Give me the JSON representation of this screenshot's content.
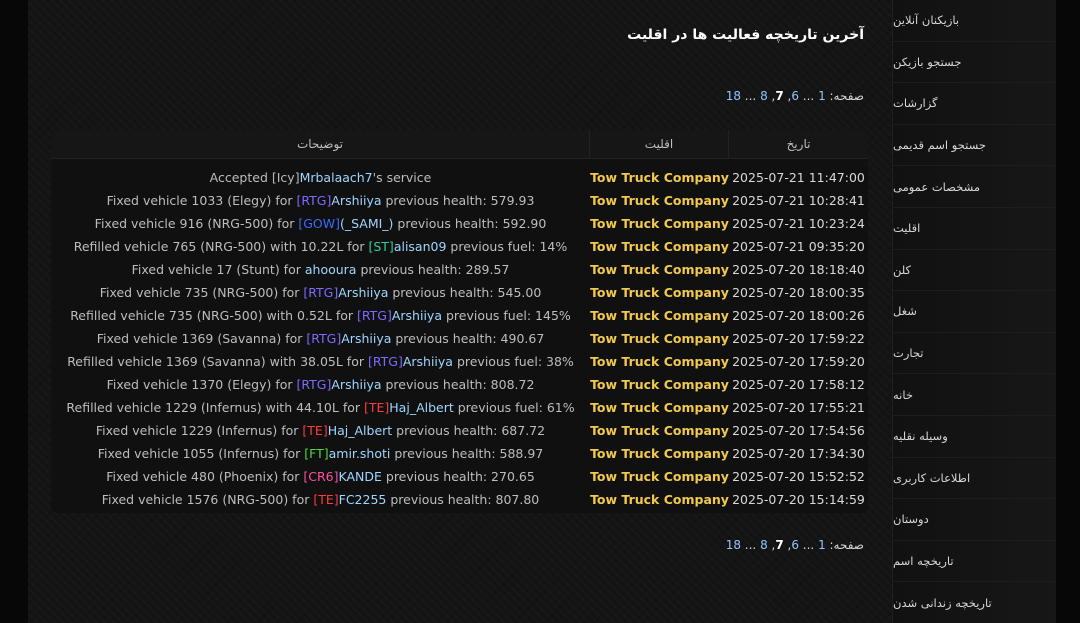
{
  "page": {
    "title": "آخرین تاریخچه فعالیت ها در اقلیت"
  },
  "pagination": {
    "label": "صفحه:",
    "pages": [
      "1",
      "...",
      "6",
      "7",
      "8",
      "...",
      "18"
    ],
    "current": "7"
  },
  "table": {
    "headers": {
      "date": "تاریخ",
      "faction": "اقلیت",
      "description": "توضیحات"
    },
    "rows": [
      {
        "date": "2025-07-21 11:47:00",
        "faction": "Tow Truck Company",
        "desc": [
          {
            "t": "Accepted "
          },
          {
            "t": "[Icy]",
            "c": "#b8b8b8"
          },
          {
            "t": "Mrbalaach7",
            "c": "#9fd6ff"
          },
          {
            "t": "'s service"
          }
        ]
      },
      {
        "date": "2025-07-21 10:28:41",
        "faction": "Tow Truck Company",
        "desc": [
          {
            "t": "Fixed vehicle 1033 (Elegy) for "
          },
          {
            "t": "[RTG]",
            "c": "#7b6cff"
          },
          {
            "t": "Arshiiya",
            "c": "#9fd6ff"
          },
          {
            "t": " previous health: 579.93"
          }
        ]
      },
      {
        "date": "2025-07-21 10:23:24",
        "faction": "Tow Truck Company",
        "desc": [
          {
            "t": "Fixed vehicle 916 (NRG-500) for "
          },
          {
            "t": "[GOW]",
            "c": "#3b6bff"
          },
          {
            "t": "(_SAMI_)",
            "c": "#9fd6ff"
          },
          {
            "t": " previous health: 592.90"
          }
        ]
      },
      {
        "date": "2025-07-21 09:35:20",
        "faction": "Tow Truck Company",
        "desc": [
          {
            "t": "Refilled vehicle 765 (NRG-500) with 10.22L for "
          },
          {
            "t": "[ST]",
            "c": "#2fcf9a"
          },
          {
            "t": "alisan09",
            "c": "#9fd6ff"
          },
          {
            "t": " previous fuel: 14%"
          }
        ]
      },
      {
        "date": "2025-07-20 18:18:40",
        "faction": "Tow Truck Company",
        "desc": [
          {
            "t": "Fixed vehicle 17 (Stunt) for "
          },
          {
            "t": "ahooura",
            "c": "#9fd6ff"
          },
          {
            "t": " previous health: 289.57"
          }
        ]
      },
      {
        "date": "2025-07-20 18:00:35",
        "faction": "Tow Truck Company",
        "desc": [
          {
            "t": "Fixed vehicle 735 (NRG-500) for "
          },
          {
            "t": "[RTG]",
            "c": "#7b6cff"
          },
          {
            "t": "Arshiiya",
            "c": "#9fd6ff"
          },
          {
            "t": " previous health: 545.00"
          }
        ]
      },
      {
        "date": "2025-07-20 18:00:26",
        "faction": "Tow Truck Company",
        "desc": [
          {
            "t": "Refilled vehicle 735 (NRG-500) with 0.52L for "
          },
          {
            "t": "[RTG]",
            "c": "#7b6cff"
          },
          {
            "t": "Arshiiya",
            "c": "#9fd6ff"
          },
          {
            "t": " previous fuel: 145%"
          }
        ]
      },
      {
        "date": "2025-07-20 17:59:22",
        "faction": "Tow Truck Company",
        "desc": [
          {
            "t": "Fixed vehicle 1369 (Savanna) for "
          },
          {
            "t": "[RTG]",
            "c": "#7b6cff"
          },
          {
            "t": "Arshiiya",
            "c": "#9fd6ff"
          },
          {
            "t": " previous health: 490.67"
          }
        ]
      },
      {
        "date": "2025-07-20 17:59:20",
        "faction": "Tow Truck Company",
        "desc": [
          {
            "t": "Refilled vehicle 1369 (Savanna) with 38.05L for "
          },
          {
            "t": "[RTG]",
            "c": "#7b6cff"
          },
          {
            "t": "Arshiiya",
            "c": "#9fd6ff"
          },
          {
            "t": " previous fuel: 38%"
          }
        ]
      },
      {
        "date": "2025-07-20 17:58:12",
        "faction": "Tow Truck Company",
        "desc": [
          {
            "t": "Fixed vehicle 1370 (Elegy) for "
          },
          {
            "t": "[RTG]",
            "c": "#7b6cff"
          },
          {
            "t": "Arshiiya",
            "c": "#9fd6ff"
          },
          {
            "t": " previous health: 808.72"
          }
        ]
      },
      {
        "date": "2025-07-20 17:55:21",
        "faction": "Tow Truck Company",
        "desc": [
          {
            "t": "Refilled vehicle 1229 (Infernus) with 44.10L for "
          },
          {
            "t": "[TE]",
            "c": "#ff3b3b"
          },
          {
            "t": "Haj_Albert",
            "c": "#9fd6ff"
          },
          {
            "t": " previous fuel: 61%"
          }
        ]
      },
      {
        "date": "2025-07-20 17:54:56",
        "faction": "Tow Truck Company",
        "desc": [
          {
            "t": "Fixed vehicle 1229 (Infernus) for "
          },
          {
            "t": "[TE]",
            "c": "#ff3b3b"
          },
          {
            "t": "Haj_Albert",
            "c": "#9fd6ff"
          },
          {
            "t": " previous health: 687.72"
          }
        ]
      },
      {
        "date": "2025-07-20 17:34:30",
        "faction": "Tow Truck Company",
        "desc": [
          {
            "t": "Fixed vehicle 1055 (Infernus) for "
          },
          {
            "t": "[FT]",
            "c": "#4cd93b"
          },
          {
            "t": "amir.shoti",
            "c": "#9fd6ff"
          },
          {
            "t": " previous health: 588.97"
          }
        ]
      },
      {
        "date": "2025-07-20 15:52:52",
        "faction": "Tow Truck Company",
        "desc": [
          {
            "t": "Fixed vehicle 480 (Phoenix) for "
          },
          {
            "t": "[CR6]",
            "c": "#ff4fa0"
          },
          {
            "t": "KANDE",
            "c": "#9fd6ff"
          },
          {
            "t": " previous health: 270.65"
          }
        ]
      },
      {
        "date": "2025-07-20 15:14:59",
        "faction": "Tow Truck Company",
        "desc": [
          {
            "t": "Fixed vehicle 1576 (NRG-500) for "
          },
          {
            "t": "[TE]",
            "c": "#ff3b3b"
          },
          {
            "t": "FC2255",
            "c": "#9fd6ff"
          },
          {
            "t": " previous health: 807.80"
          }
        ]
      }
    ]
  },
  "sidebar": {
    "items": [
      "بازیکنان آنلاین",
      "جستجو بازیکن",
      "گزارشات",
      "جستجو اسم قدیمی",
      "مشخصات عمومی",
      "اقلیت",
      "کلن",
      "شغل",
      "تجارت",
      "خانه",
      "وسیله نقلیه",
      "اطلاعات کاربری",
      "دوستان",
      "تاریخچه اسم",
      "تاریخچه زندانی شدن"
    ]
  }
}
